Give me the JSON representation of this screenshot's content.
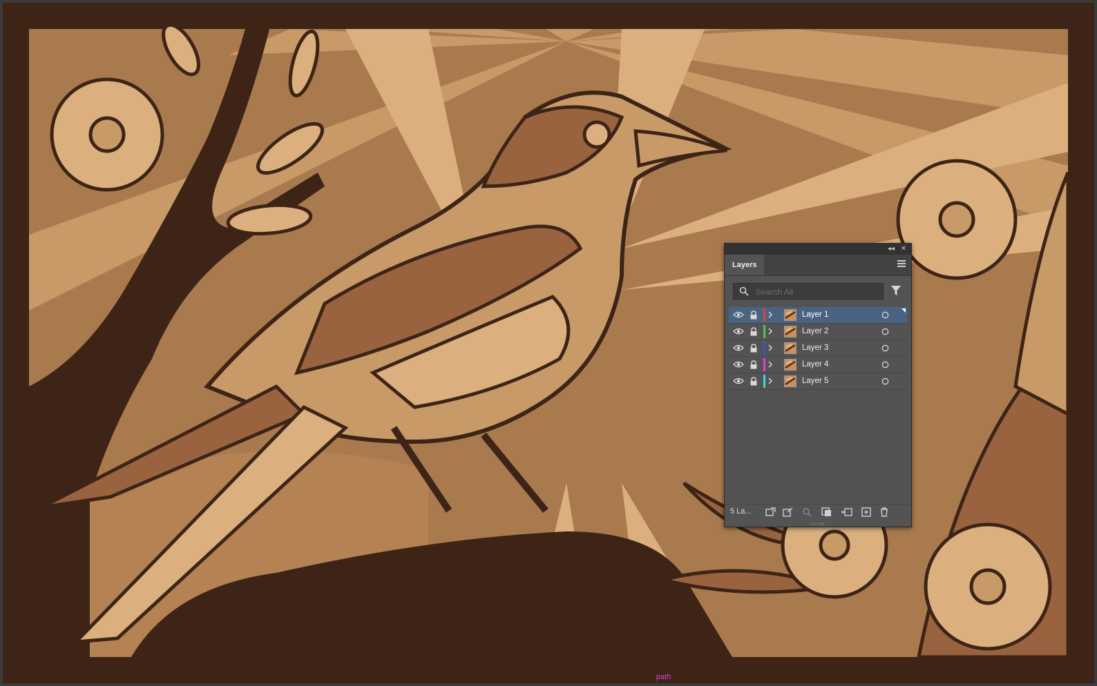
{
  "canvas": {
    "status_hint": "path",
    "colors": {
      "frame": "#3d2416",
      "light": "#e2b888",
      "mid": "#c8935e",
      "dark": "#9a6340",
      "outline": "#3d2416"
    }
  },
  "layers_panel": {
    "tab_label": "Layers",
    "search_placeholder": "Search All",
    "layer_count": "5 La...",
    "layers": [
      {
        "name": "Layer 1",
        "color": "#e0413c",
        "selected": true
      },
      {
        "name": "Layer 2",
        "color": "#3dd24a",
        "selected": false
      },
      {
        "name": "Layer 3",
        "color": "#3b53d9",
        "selected": false
      },
      {
        "name": "Layer 4",
        "color": "#e040d8",
        "selected": false
      },
      {
        "name": "Layer 5",
        "color": "#3fd6d6",
        "selected": false
      }
    ],
    "icons": {
      "visibility": "eye-icon",
      "lock": "lock-icon",
      "expand": "chevron-right-icon",
      "target": "target-circle-icon",
      "search": "search-icon",
      "filter": "filter-icon",
      "menu": "hamburger-menu-icon"
    }
  }
}
